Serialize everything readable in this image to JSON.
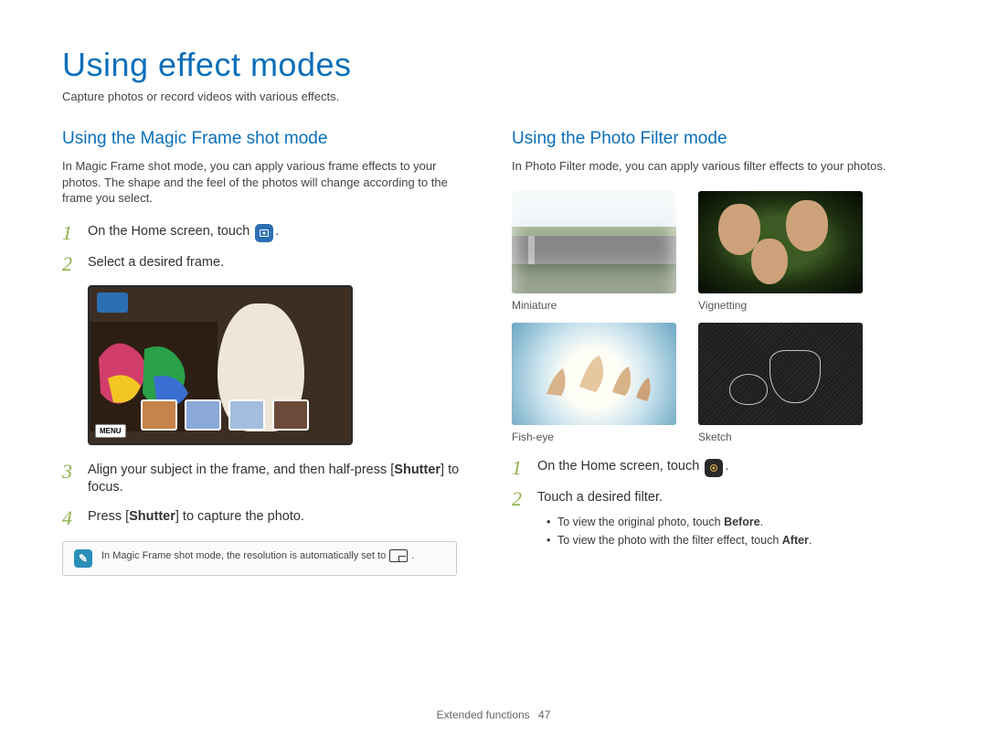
{
  "page": {
    "title": "Using effect modes",
    "subtitle": "Capture photos or record videos with various effects."
  },
  "left": {
    "heading": "Using the Magic Frame shot mode",
    "intro": "In Magic Frame shot mode, you can apply various frame effects to your photos. The shape and the feel of the photos will change according to the frame you select.",
    "steps": [
      {
        "num": "1",
        "text_before": "On the Home screen, touch ",
        "text_after": ".",
        "icon": "magic-frame-icon"
      },
      {
        "num": "2",
        "text": "Select a desired frame."
      },
      {
        "num": "3",
        "text_before": "Align your subject in the frame, and then half-press [",
        "bold": "Shutter",
        "text_after": "] to focus."
      },
      {
        "num": "4",
        "text_before": "Press [",
        "bold": "Shutter",
        "text_after": "] to capture the photo."
      }
    ],
    "menu_label": "MENU",
    "note": {
      "text_before": "In Magic Frame shot mode, the resolution is automatically set to",
      "text_after": "."
    }
  },
  "right": {
    "heading": "Using the Photo Filter mode",
    "intro": "In Photo Filter mode, you can apply various filter effects to your photos.",
    "filters": [
      {
        "key": "miniature",
        "label": "Miniature"
      },
      {
        "key": "vignetting",
        "label": "Vignetting"
      },
      {
        "key": "fisheye",
        "label": "Fish-eye"
      },
      {
        "key": "sketch",
        "label": "Sketch"
      }
    ],
    "steps": [
      {
        "num": "1",
        "text_before": "On the Home screen, touch ",
        "text_after": ".",
        "icon": "photo-filter-icon"
      },
      {
        "num": "2",
        "text": "Touch a desired filter."
      }
    ],
    "sub_bullets": [
      {
        "text_before": "To view the original photo, touch ",
        "bold": "Before",
        "text_after": "."
      },
      {
        "text_before": "To view the photo with the filter effect, touch ",
        "bold": "After",
        "text_after": "."
      }
    ]
  },
  "footer": {
    "section": "Extended functions",
    "page_number": "47"
  }
}
